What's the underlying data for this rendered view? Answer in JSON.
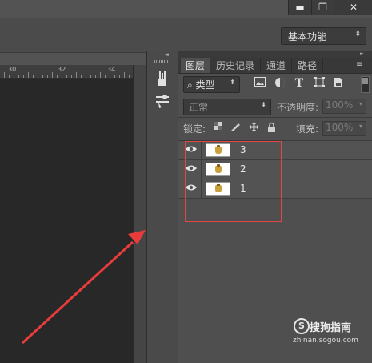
{
  "window": {
    "minimize_label": "▬",
    "maximize_label": "❐",
    "close_label": "✕"
  },
  "options_bar": {
    "workspace_label": "基本功能",
    "workspace_caret": "⬍"
  },
  "ruler": {
    "labels": [
      "30",
      "32",
      "34"
    ]
  },
  "toolstrip": {
    "collapse": "◂◂",
    "icons": [
      "brushes-icon",
      "brush-settings-icon"
    ]
  },
  "layers_panel": {
    "collapse": "▸▸",
    "tabs": [
      "图层",
      "历史记录",
      "通道",
      "路径"
    ],
    "active_tab": "图层",
    "menu_icon": "≡",
    "filter": {
      "label": "⌕ 类型",
      "caret": "⬍",
      "icons": [
        "image-filter-icon",
        "adjustment-filter-icon",
        "type-filter-icon",
        "shape-filter-icon",
        "smart-object-filter-icon"
      ]
    },
    "blend_mode": "正常",
    "opacity_label": "不透明度:",
    "opacity_value": "100%",
    "lock_label": "锁定:",
    "fill_label": "填充:",
    "fill_value": "100%",
    "caret": "▾",
    "layers": [
      {
        "name": "3",
        "visible": true
      },
      {
        "name": "2",
        "visible": true
      },
      {
        "name": "1",
        "visible": true
      }
    ]
  },
  "annotation": {
    "box_color": "#e04848",
    "arrow_color": "#e83c3c"
  },
  "watermark": {
    "logo": "S",
    "text": "搜狗指南",
    "url": "zhinan.sogou.com"
  }
}
